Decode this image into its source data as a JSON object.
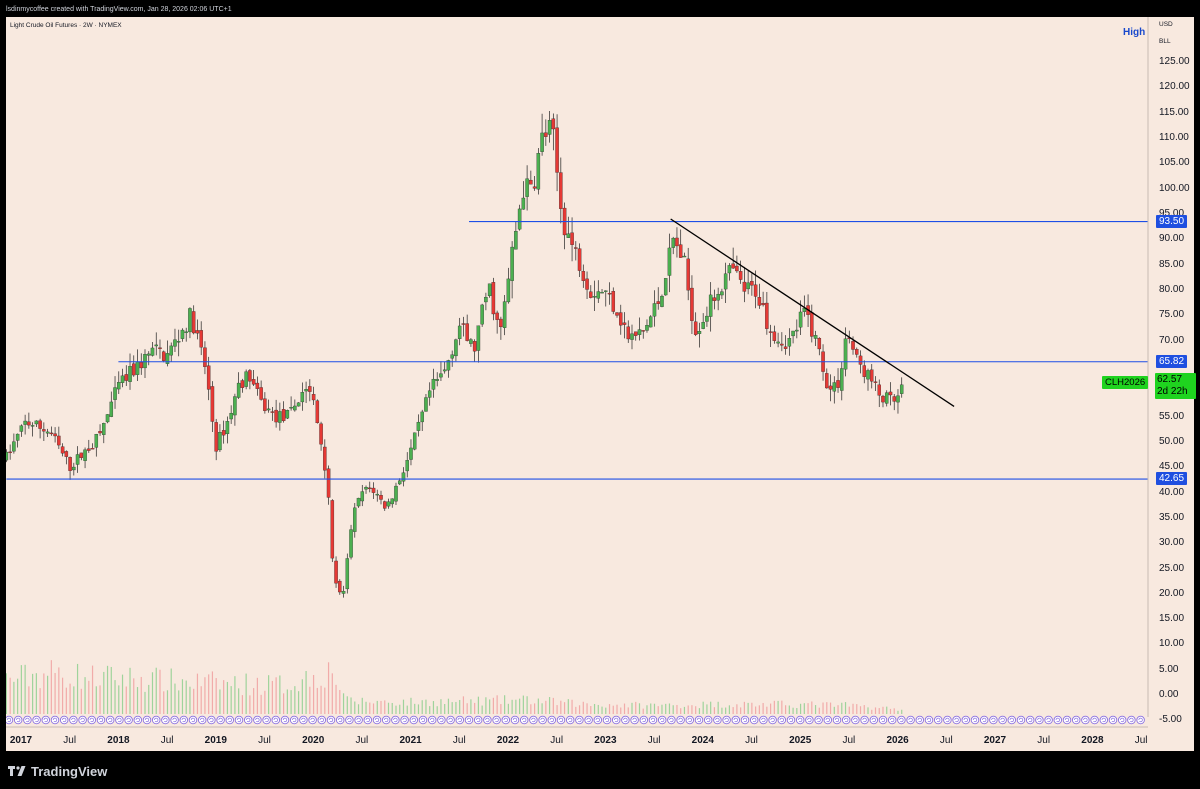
{
  "header": {
    "attribution": "lsdinmycoffee created with TradingView.com, Jan 28, 2026 02:06 UTC+1"
  },
  "legend": {
    "title": "Light Crude Oil Futures · 2W · NYMEX"
  },
  "toolbar": {
    "high_label": "High"
  },
  "scale": {
    "currency": "USD",
    "unit": "BLL"
  },
  "footer": {
    "brand": "TradingView"
  },
  "colors": {
    "up": "#4caf50",
    "down": "#e53935",
    "level_line": "#1e4fe6",
    "trendline": "#000000",
    "badge_green": "#1fd31f",
    "background": "#f8e9df"
  },
  "chart_data": {
    "type": "candlestick",
    "symbol": "CLH2026",
    "interval": "2W",
    "exchange": "NYMEX",
    "last_price": "62.57",
    "countdown": "2d 22h",
    "ylim": [
      -5,
      130
    ],
    "y_ticks": [
      "125.00",
      "120.00",
      "115.00",
      "110.00",
      "105.00",
      "100.00",
      "95.00",
      "90.00",
      "85.00",
      "80.00",
      "75.00",
      "70.00",
      "65.00",
      "60.00",
      "55.00",
      "50.00",
      "45.00",
      "40.00",
      "35.00",
      "30.00",
      "25.00",
      "20.00",
      "15.00",
      "10.00",
      "5.00",
      "0.00",
      "-5.00"
    ],
    "x_ticks": [
      {
        "label": "2017",
        "t": 2017.0,
        "year": true
      },
      {
        "label": "Jul",
        "t": 2017.5
      },
      {
        "label": "2018",
        "t": 2018.0,
        "year": true
      },
      {
        "label": "Jul",
        "t": 2018.5
      },
      {
        "label": "2019",
        "t": 2019.0,
        "year": true
      },
      {
        "label": "Jul",
        "t": 2019.5
      },
      {
        "label": "2020",
        "t": 2020.0,
        "year": true
      },
      {
        "label": "Jul",
        "t": 2020.5
      },
      {
        "label": "2021",
        "t": 2021.0,
        "year": true
      },
      {
        "label": "Jul",
        "t": 2021.5
      },
      {
        "label": "2022",
        "t": 2022.0,
        "year": true
      },
      {
        "label": "Jul",
        "t": 2022.5
      },
      {
        "label": "2023",
        "t": 2023.0,
        "year": true
      },
      {
        "label": "Jul",
        "t": 2023.5
      },
      {
        "label": "2024",
        "t": 2024.0,
        "year": true
      },
      {
        "label": "Jul",
        "t": 2024.5
      },
      {
        "label": "2025",
        "t": 2025.0,
        "year": true
      },
      {
        "label": "Jul",
        "t": 2025.5
      },
      {
        "label": "2026",
        "t": 2026.0,
        "year": true
      },
      {
        "label": "Jul",
        "t": 2026.5
      },
      {
        "label": "2027",
        "t": 2027.0,
        "year": true
      },
      {
        "label": "Jul",
        "t": 2027.5
      },
      {
        "label": "2028",
        "t": 2028.0,
        "year": true
      },
      {
        "label": "Jul",
        "t": 2028.5
      }
    ],
    "levels": [
      {
        "label": "93.50",
        "price": 93.5,
        "from": 2021.6
      },
      {
        "label": "65.82",
        "price": 65.82,
        "from": 2018.0
      },
      {
        "label": "42.65",
        "price": 42.65,
        "from": 2016.85
      }
    ],
    "trendline": {
      "from": {
        "t": 2023.67,
        "price": 94.0
      },
      "to": {
        "t": 2026.58,
        "price": 57.0
      }
    },
    "anchors": [
      [
        2016.85,
        47
      ],
      [
        2017.05,
        54
      ],
      [
        2017.3,
        52
      ],
      [
        2017.5,
        45
      ],
      [
        2017.8,
        51
      ],
      [
        2018.0,
        61
      ],
      [
        2018.15,
        64
      ],
      [
        2018.35,
        68
      ],
      [
        2018.5,
        67
      ],
      [
        2018.75,
        75
      ],
      [
        2018.9,
        64
      ],
      [
        2019.0,
        49
      ],
      [
        2019.12,
        54
      ],
      [
        2019.25,
        62
      ],
      [
        2019.35,
        63
      ],
      [
        2019.45,
        58
      ],
      [
        2019.6,
        55
      ],
      [
        2019.75,
        55
      ],
      [
        2019.92,
        61
      ],
      [
        2020.0,
        58
      ],
      [
        2020.08,
        50
      ],
      [
        2020.15,
        42
      ],
      [
        2020.2,
        25
      ],
      [
        2020.3,
        18
      ],
      [
        2020.4,
        35
      ],
      [
        2020.5,
        40
      ],
      [
        2020.6,
        41
      ],
      [
        2020.75,
        37
      ],
      [
        2020.85,
        41
      ],
      [
        2021.0,
        48
      ],
      [
        2021.2,
        60
      ],
      [
        2021.35,
        64
      ],
      [
        2021.5,
        73
      ],
      [
        2021.65,
        68
      ],
      [
        2021.8,
        81
      ],
      [
        2021.92,
        71
      ],
      [
        2022.05,
        88
      ],
      [
        2022.15,
        100
      ],
      [
        2022.25,
        100
      ],
      [
        2022.35,
        110
      ],
      [
        2022.45,
        112
      ],
      [
        2022.55,
        95
      ],
      [
        2022.65,
        89
      ],
      [
        2022.75,
        85
      ],
      [
        2022.85,
        80
      ],
      [
        2022.97,
        80
      ],
      [
        2023.1,
        77
      ],
      [
        2023.25,
        70
      ],
      [
        2023.4,
        72
      ],
      [
        2023.55,
        78
      ],
      [
        2023.7,
        90
      ],
      [
        2023.8,
        86
      ],
      [
        2023.92,
        72
      ],
      [
        2024.05,
        76
      ],
      [
        2024.15,
        80
      ],
      [
        2024.3,
        84
      ],
      [
        2024.42,
        80
      ],
      [
        2024.55,
        80
      ],
      [
        2024.68,
        73
      ],
      [
        2024.8,
        70
      ],
      [
        2024.9,
        70
      ],
      [
        2025.05,
        76
      ],
      [
        2025.18,
        69
      ],
      [
        2025.3,
        60
      ],
      [
        2025.4,
        62
      ],
      [
        2025.48,
        72
      ],
      [
        2025.58,
        66
      ],
      [
        2025.7,
        63
      ],
      [
        2025.82,
        59
      ],
      [
        2025.92,
        58
      ],
      [
        2026.0,
        58
      ],
      [
        2026.07,
        62.57
      ]
    ],
    "volume": [
      [
        2016.85,
        0.32
      ],
      [
        2017.3,
        0.38
      ],
      [
        2017.7,
        0.34
      ],
      [
        2018.2,
        0.33
      ],
      [
        2018.6,
        0.3
      ],
      [
        2019.2,
        0.28
      ],
      [
        2019.7,
        0.27
      ],
      [
        2020.2,
        0.4
      ],
      [
        2020.35,
        0.12
      ],
      [
        2021.0,
        0.11
      ],
      [
        2021.6,
        0.12
      ],
      [
        2022.2,
        0.13
      ],
      [
        2022.8,
        0.09
      ],
      [
        2023.5,
        0.08
      ],
      [
        2024.2,
        0.09
      ],
      [
        2024.9,
        0.09
      ],
      [
        2025.5,
        0.08
      ],
      [
        2026.07,
        0.04
      ]
    ]
  }
}
